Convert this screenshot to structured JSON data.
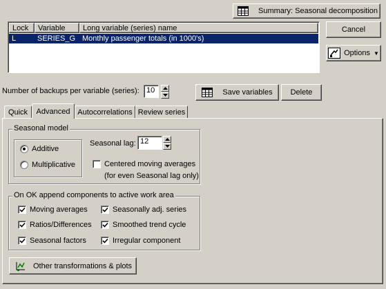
{
  "summary_button": {
    "label": "Summary:  Seasonal decomposition",
    "icon": "table-grid-icon"
  },
  "cancel_button": {
    "label": "Cancel"
  },
  "options_button": {
    "label": "Options",
    "icon": "options-icon"
  },
  "variable_table": {
    "headers": [
      "Lock",
      "Variable",
      "Long variable (series) name"
    ],
    "rows": [
      {
        "lock": "L",
        "variable": "SERIES_G",
        "name": "Monthly passenger totals (in 1000's)"
      }
    ]
  },
  "backups": {
    "label": "Number of backups per variable (series):",
    "value": "10"
  },
  "save_variables_button": {
    "label": "Save variables",
    "icon": "save-variables-icon"
  },
  "delete_button": {
    "label": "Delete"
  },
  "tabs": [
    {
      "label": "Quick",
      "active": false
    },
    {
      "label": "Advanced",
      "active": true
    },
    {
      "label": "Autocorrelations",
      "active": false
    },
    {
      "label": "Review series",
      "active": false
    }
  ],
  "seasonal_model": {
    "group_label": "Seasonal model",
    "options": [
      {
        "label": "Additive",
        "selected": true
      },
      {
        "label": "Multiplicative",
        "selected": false
      }
    ],
    "seasonal_lag_label": "Seasonal lag:",
    "seasonal_lag_value": "12",
    "centered_ma": {
      "line1": "Centered moving averages",
      "line2": "(for even Seasonal lag only)",
      "checked": false
    }
  },
  "append_components": {
    "group_label": "On OK append components to active work area",
    "items": [
      {
        "label": "Moving averages",
        "checked": true
      },
      {
        "label": "Seasonally adj. series",
        "checked": true
      },
      {
        "label": "Ratios/Differences",
        "checked": true
      },
      {
        "label": "Smoothed trend cycle",
        "checked": true
      },
      {
        "label": "Seasonal factors",
        "checked": true
      },
      {
        "label": "Irregular component",
        "checked": true
      }
    ]
  },
  "other_transformations_button": {
    "label": "Other transformations & plots",
    "icon": "transform-plots-icon"
  },
  "colors": {
    "selection": "#0a246a",
    "background": "#d4d0c8"
  }
}
